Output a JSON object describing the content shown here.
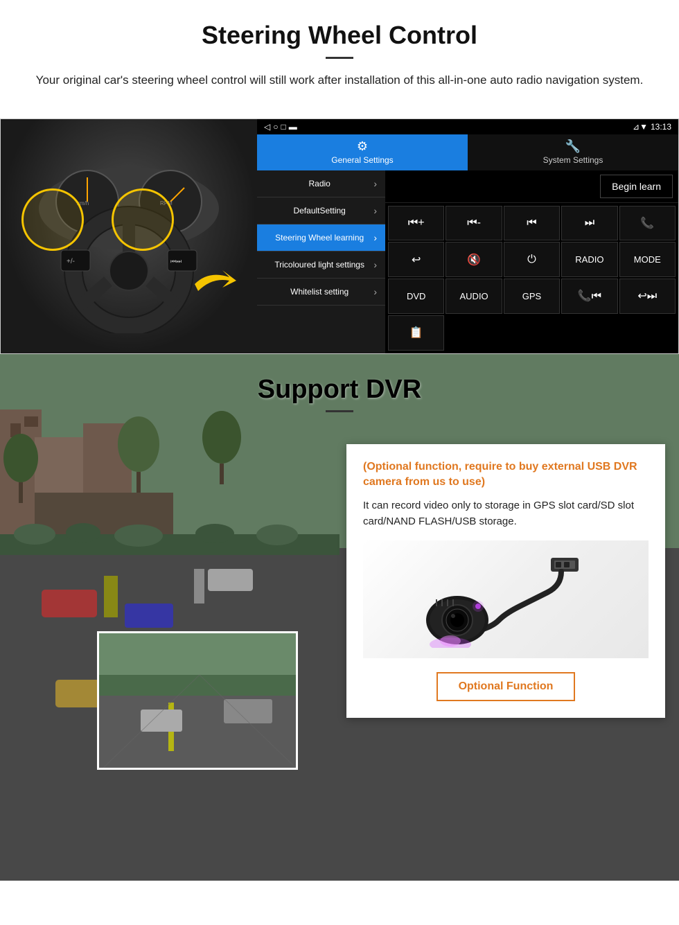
{
  "steering_section": {
    "title": "Steering Wheel Control",
    "subtitle": "Your original car's steering wheel control will still work after installation of this all-in-one auto radio navigation system.",
    "statusbar": {
      "time": "13:13",
      "icons": "⊿ ▼"
    },
    "tabs": {
      "general": {
        "icon": "⚙",
        "label": "General Settings"
      },
      "system": {
        "icon": "🔧",
        "label": "System Settings"
      }
    },
    "menu_items": [
      {
        "label": "Radio",
        "active": false
      },
      {
        "label": "DefaultSetting",
        "active": false
      },
      {
        "label": "Steering Wheel learning",
        "active": true
      },
      {
        "label": "Tricoloured light settings",
        "active": false
      },
      {
        "label": "Whitelist setting",
        "active": false
      }
    ],
    "begin_learn": "Begin learn",
    "controls": [
      "⏮+",
      "⏮-",
      "⏮⏮",
      "⏭⏭",
      "📞",
      "↩",
      "🔇",
      "⏻",
      "RADIO",
      "MODE",
      "DVD",
      "AUDIO",
      "GPS",
      "📞⏮",
      "↩⏭",
      "📋"
    ]
  },
  "dvr_section": {
    "title": "Support DVR",
    "optional_text": "(Optional function, require to buy external USB DVR camera from us to use)",
    "description": "It can record video only to storage in GPS slot card/SD slot card/NAND FLASH/USB storage.",
    "optional_function_btn": "Optional Function"
  }
}
